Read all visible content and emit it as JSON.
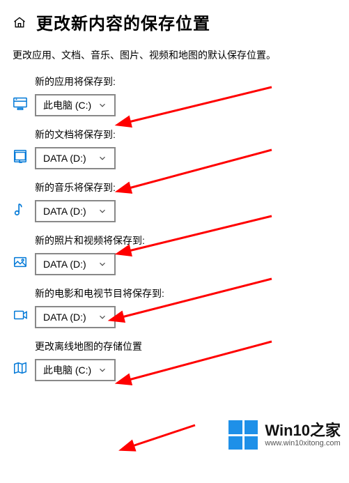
{
  "header": {
    "title": "更改新内容的保存位置"
  },
  "subtitle": "更改应用、文档、音乐、图片、视频和地图的默认保存位置。",
  "options": {
    "c": "此电脑 (C:)",
    "d": "DATA (D:)"
  },
  "sections": {
    "apps": {
      "label": "新的应用将保存到:",
      "selected": "此电脑 (C:)"
    },
    "docs": {
      "label": "新的文档将保存到:",
      "selected": "DATA (D:)"
    },
    "music": {
      "label": "新的音乐将保存到:",
      "selected": "DATA (D:)"
    },
    "photos": {
      "label": "新的照片和视频将保存到:",
      "selected": "DATA (D:)"
    },
    "movies": {
      "label": "新的电影和电视节目将保存到:",
      "selected": "DATA (D:)"
    },
    "maps": {
      "label": "更改离线地图的存储位置",
      "selected": "此电脑 (C:)"
    }
  },
  "watermark": {
    "brand": "Win10之家",
    "url": "www.win10xitong.com"
  },
  "accent_color": "#0078d7",
  "annotation_color": "#ff0000"
}
